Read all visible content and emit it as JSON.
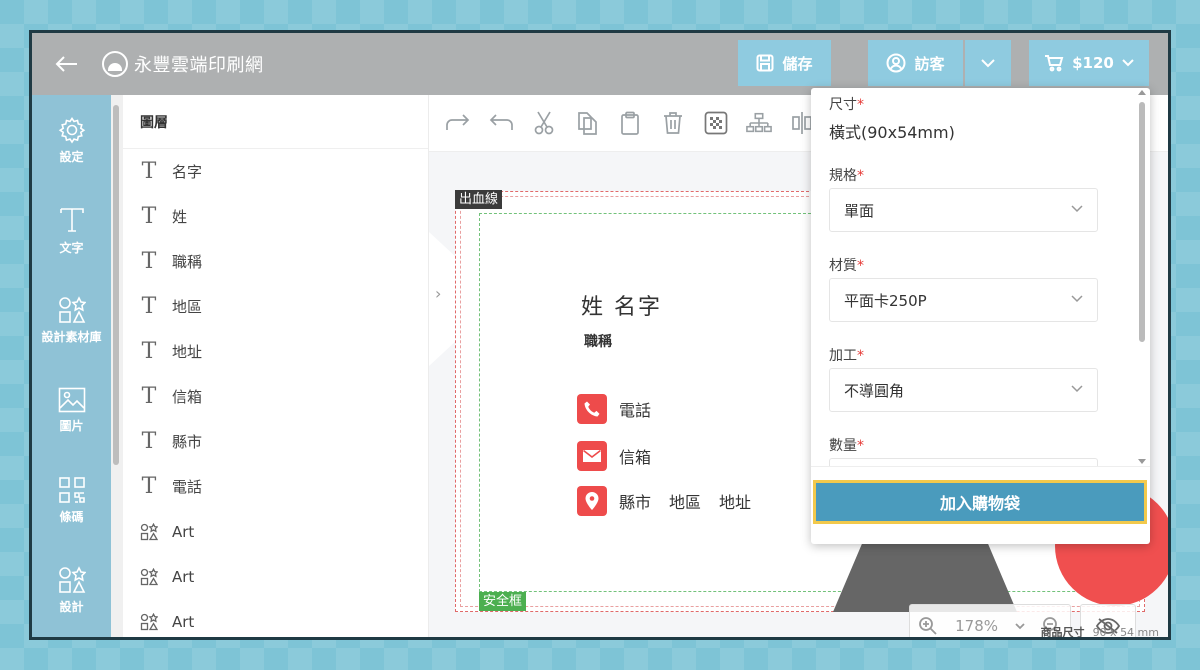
{
  "header": {
    "brand": "永豐雲端印刷網",
    "save_label": "儲存",
    "user_label": "訪客",
    "cart_label": "$120"
  },
  "leftnav": {
    "items": [
      {
        "label": "設定",
        "icon": "gear-icon"
      },
      {
        "label": "文字",
        "icon": "text-icon"
      },
      {
        "label": "設計素材庫",
        "icon": "shapes-icon"
      },
      {
        "label": "圖片",
        "icon": "image-icon"
      },
      {
        "label": "條碼",
        "icon": "qrcode-icon"
      },
      {
        "label": "設計",
        "icon": "shapes-icon"
      }
    ]
  },
  "layers": {
    "title": "圖層",
    "items": [
      {
        "type": "text",
        "label": "名字"
      },
      {
        "type": "text",
        "label": "姓"
      },
      {
        "type": "text",
        "label": "職稱"
      },
      {
        "type": "text",
        "label": "地區"
      },
      {
        "type": "text",
        "label": "地址"
      },
      {
        "type": "text",
        "label": "信箱"
      },
      {
        "type": "text",
        "label": "縣市"
      },
      {
        "type": "text",
        "label": "電話"
      },
      {
        "type": "art",
        "label": "Art"
      },
      {
        "type": "art",
        "label": "Art"
      },
      {
        "type": "art",
        "label": "Art"
      }
    ]
  },
  "toolbar": {
    "tools": [
      "redo-icon",
      "undo-icon",
      "cut-icon",
      "copy-icon",
      "paste-icon",
      "delete-icon",
      "pattern-icon",
      "tree-icon",
      "align-icon"
    ]
  },
  "canvas": {
    "bleed_label": "出血線",
    "safe_label": "安全框",
    "name": "姓 名字",
    "title": "職稱",
    "phone_label": "電話",
    "email_label": "信箱",
    "address": {
      "city": "縣市",
      "district": "地區",
      "street": "地址"
    },
    "zoom_level": "178%",
    "product_size_label": "商品尺寸",
    "product_size_value": "90 x 54 mm"
  },
  "options_panel": {
    "size_label": "尺寸",
    "size_value": "橫式(90x54mm)",
    "spec_label": "規格",
    "spec_value": "單面",
    "material_label": "材質",
    "material_value": "平面卡250P",
    "finish_label": "加工",
    "finish_value": "不導圓角",
    "quantity_label": "數量",
    "required_mark": "*",
    "add_to_cart_label": "加入購物袋"
  },
  "colors": {
    "header_bg": "#aeb0b1",
    "nav_bg": "#8fc2d6",
    "button_bg": "#8fcbe0",
    "cta_bg": "#4a9bbd",
    "cta_border": "#f2c94c",
    "accent_red": "#ee4b4b"
  }
}
